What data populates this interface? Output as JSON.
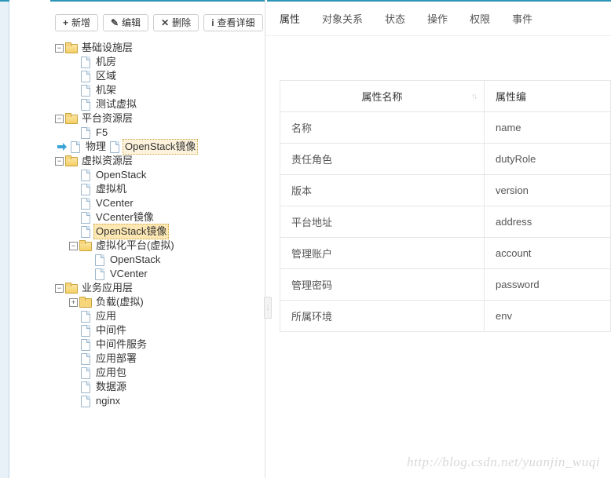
{
  "toolbar": {
    "add": "新增",
    "edit": "编辑",
    "delete": "删除",
    "detail": "查看详细"
  },
  "cursorInsert": "OpenStack镜像",
  "tree": {
    "n1": {
      "label": "基础设施层"
    },
    "n1c": {
      "a": "机房",
      "b": "区域",
      "c": "机架",
      "d": "测试虚拟"
    },
    "n2": {
      "label": "平台资源层"
    },
    "n2c": {
      "a": "F5",
      "b": "物理"
    },
    "n3": {
      "label": "虚拟资源层"
    },
    "n3c": {
      "a": "OpenStack",
      "b": "虚拟机",
      "c": "VCenter",
      "d": "VCenter镜像",
      "e": "OpenStack镜像"
    },
    "n3f": {
      "label": "虚拟化平台(虚拟)"
    },
    "n3fc": {
      "a": "OpenStack",
      "b": "VCenter"
    },
    "n4": {
      "label": "业务应用层"
    },
    "n4a": {
      "label": "负载(虚拟)"
    },
    "n4c": {
      "b": "应用",
      "c": "中间件",
      "d": "中间件服务",
      "e": "应用部署",
      "f": "应用包",
      "g": "数据源",
      "h": "nginx"
    }
  },
  "tabs": {
    "a": "属性",
    "b": "对象关系",
    "c": "状态",
    "d": "操作",
    "e": "权限",
    "f": "事件"
  },
  "table": {
    "col1": "属性名称",
    "col2": "属性编",
    "rows": [
      {
        "name": "名称",
        "code": "name"
      },
      {
        "name": "责任角色",
        "code": "dutyRole"
      },
      {
        "name": "版本",
        "code": "version"
      },
      {
        "name": "平台地址",
        "code": "address"
      },
      {
        "name": "管理账户",
        "code": "account"
      },
      {
        "name": "管理密码",
        "code": "password"
      },
      {
        "name": "所属环境",
        "code": "env"
      }
    ]
  },
  "watermark": {
    "text": "http://blog.csdn.net/yuanjin_wuqi"
  }
}
